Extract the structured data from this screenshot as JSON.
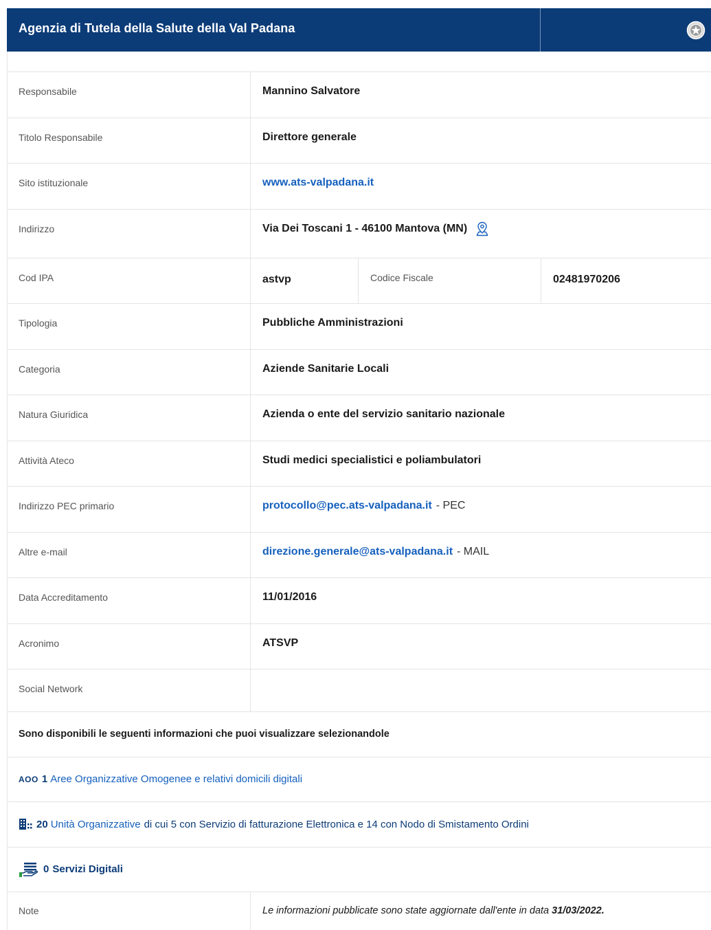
{
  "header": {
    "title": "Agenzia di Tutela della Salute della Val Padana",
    "emblem_icon": "italian-republic-emblem-icon"
  },
  "colors": {
    "header_bg": "#0c3c78",
    "link": "#1560bd",
    "border": "#e4e4e4"
  },
  "details": {
    "responsabile": {
      "label": "Responsabile",
      "value": "Mannino Salvatore"
    },
    "titolo": {
      "label": "Titolo Responsabile",
      "value": "Direttore generale"
    },
    "sito": {
      "label": "Sito istituzionale",
      "value": "www.ats-valpadana.it"
    },
    "indirizzo": {
      "label": "Indirizzo",
      "value": "Via Dei Toscani 1 - 46100 Mantova (MN)",
      "icon": "map-pin-icon"
    },
    "cod_ipa": {
      "label": "Cod IPA",
      "value": "astvp"
    },
    "codice_fiscale": {
      "label": "Codice Fiscale",
      "value": "02481970206"
    },
    "tipologia": {
      "label": "Tipologia",
      "value": "Pubbliche Amministrazioni"
    },
    "categoria": {
      "label": "Categoria",
      "value": "Aziende Sanitarie Locali"
    },
    "natura": {
      "label": "Natura Giuridica",
      "value": "Azienda o ente del servizio sanitario nazionale"
    },
    "ateco": {
      "label": "Attività Ateco",
      "value": "Studi medici specialistici e poliambulatori"
    },
    "pec": {
      "label": "Indirizzo PEC primario",
      "value": "protocollo@pec.ats-valpadana.it",
      "suffix": "- PEC"
    },
    "email": {
      "label": "Altre e-mail",
      "value": "direzione.generale@ats-valpadana.it",
      "suffix": "- MAIL"
    },
    "data_accreditamento": {
      "label": "Data Accreditamento",
      "value": "11/01/2016"
    },
    "acronimo": {
      "label": "Acronimo",
      "value": "ATSVP"
    },
    "social": {
      "label": "Social Network",
      "value": ""
    }
  },
  "info": {
    "intro": "Sono disponibili le seguenti informazioni che puoi visualizzare selezionandole",
    "aoo": {
      "tag": "AOO",
      "count": "1",
      "link": "Aree Organizzative Omogenee e relativi domicili digitali"
    },
    "uo": {
      "count": "20",
      "link": "Unità Organizzative",
      "rest": "di cui 5 con Servizio di fatturazione Elettronica e 14 con Nodo di Smistamento Ordini",
      "icon": "building-icon"
    },
    "servizi": {
      "count": "0",
      "label": "Servizi Digitali",
      "icon": "hand-service-icon"
    }
  },
  "note": {
    "label": "Note",
    "text": "Le informazioni pubblicate sono state aggiornate dall'ente in data",
    "date": "31/03/2022."
  }
}
